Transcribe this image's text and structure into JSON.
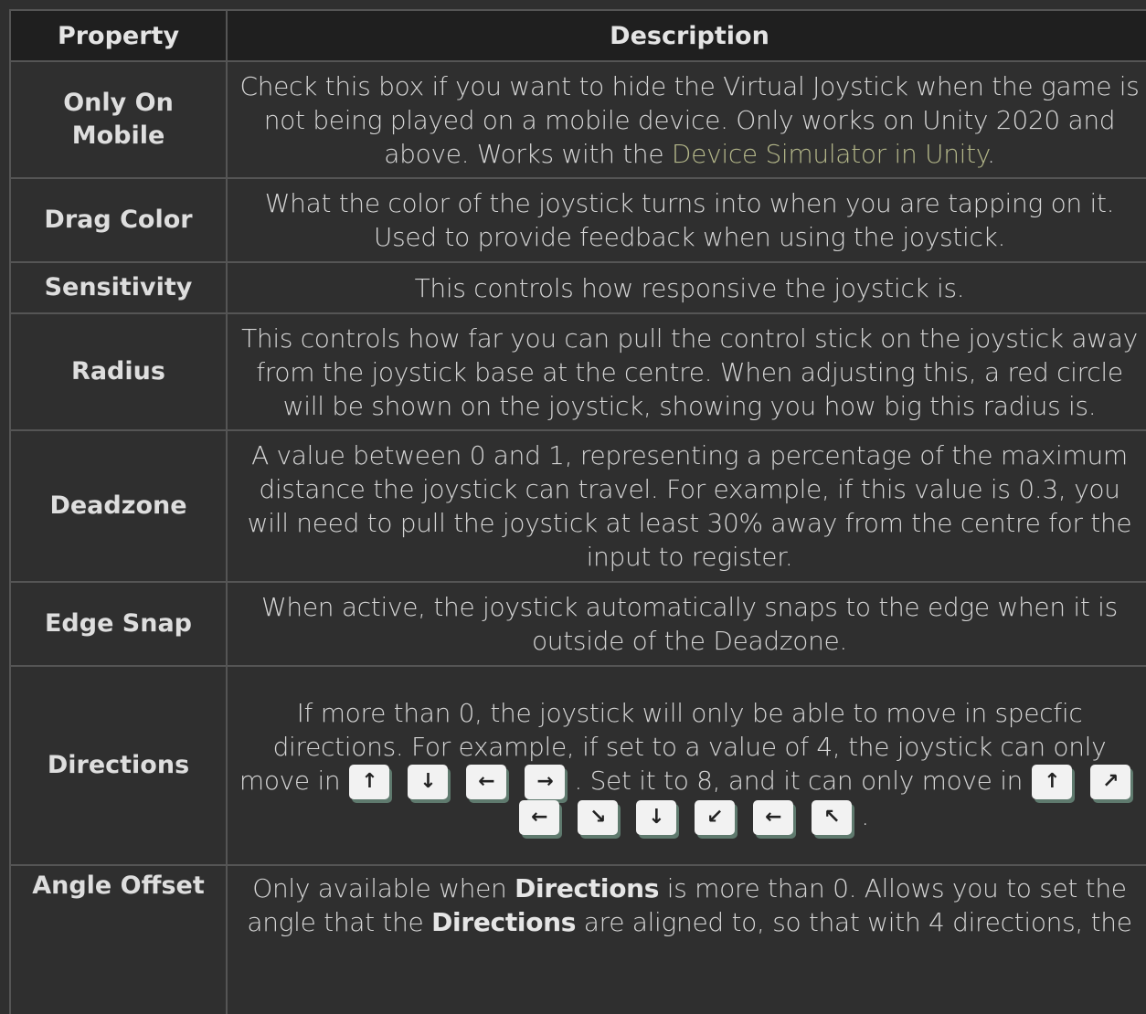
{
  "table": {
    "headers": [
      "Property",
      "Description"
    ],
    "rows": [
      {
        "property": "Only On Mobile",
        "description_before": "Check this box if you want to hide the Virtual Joystick when the game is not being played on a mobile device. Only works on Unity 2020 and above. Works with the ",
        "link_text": "Device Simulator in Unity",
        "description_after": "."
      },
      {
        "property": "Drag Color",
        "description": "What the color of the joystick turns into when you are tapping on it. Used to provide feedback when using the joystick."
      },
      {
        "property": "Sensitivity",
        "description": "This controls how responsive the joystick is."
      },
      {
        "property": "Radius",
        "description": "This controls how far you can pull the control stick on the joystick away from the joystick base at the centre. When adjusting this, a red circle will be shown on the joystick, showing you how big this radius is."
      },
      {
        "property": "Deadzone",
        "description": "A value between 0 and 1, representing a percentage of the maximum distance the joystick can travel. For example, if this value is 0.3, you will need to pull the joystick at least 30% away from the centre for the input to register."
      },
      {
        "property": "Edge Snap",
        "description": "When active, the joystick automatically snaps to the edge when it is outside of the Deadzone."
      },
      {
        "property": "Directions",
        "text_1": "If more than 0, the joystick will only be able to move in specfic directions. For example, if set to a value of 4, the joystick can only move in",
        "keys_4": [
          "↑",
          "↓",
          "←",
          "→"
        ],
        "text_2": ". Set it to 8, and it can only move in",
        "keys_8": [
          "↑",
          "↗",
          "←",
          "↘",
          "↓",
          "↙",
          "←",
          "↖"
        ],
        "text_3": "."
      },
      {
        "property": "Angle Offset",
        "text_1": "Only available when ",
        "bold_1": "Directions",
        "text_2": " is more than 0. Allows you to set the angle that the ",
        "bold_2": "Directions",
        "text_3": " are aligned to, so that with 4 directions, the"
      }
    ]
  },
  "colors": {
    "background": "#2f2f2f",
    "header_background": "#1f1f1f",
    "link": "#b5b88a",
    "key_background": "#f2f2f2",
    "key_shadow": "#5f7a6e"
  }
}
